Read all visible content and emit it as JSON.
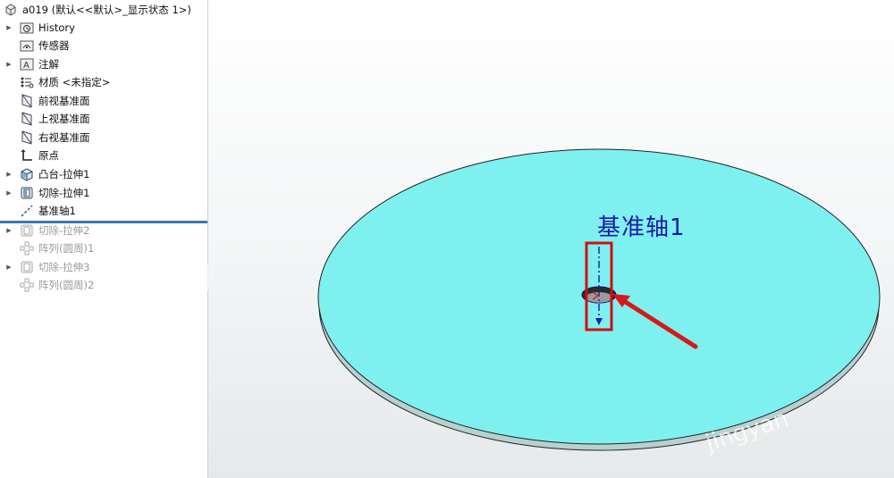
{
  "tree": {
    "root": "a019  (默认<<默认>_显示状态 1>)",
    "items": [
      {
        "label": "History",
        "icon": "history-folder-icon",
        "expandable": true,
        "suppressed": false
      },
      {
        "label": "传感器",
        "icon": "sensor-icon",
        "expandable": false,
        "suppressed": false
      },
      {
        "label": "注解",
        "icon": "annotation-icon",
        "expandable": true,
        "suppressed": false
      },
      {
        "label": "材质 <未指定>",
        "icon": "material-icon",
        "expandable": false,
        "suppressed": false
      },
      {
        "label": "前视基准面",
        "icon": "plane-icon",
        "expandable": false,
        "suppressed": false
      },
      {
        "label": "上视基准面",
        "icon": "plane-icon",
        "expandable": false,
        "suppressed": false
      },
      {
        "label": "右视基准面",
        "icon": "plane-icon",
        "expandable": false,
        "suppressed": false
      },
      {
        "label": "原点",
        "icon": "origin-icon",
        "expandable": false,
        "suppressed": false
      },
      {
        "label": "凸台-拉伸1",
        "icon": "boss-extrude-icon",
        "expandable": true,
        "suppressed": false
      },
      {
        "label": "切除-拉伸1",
        "icon": "cut-extrude-icon",
        "expandable": true,
        "suppressed": false
      },
      {
        "label": "基准轴1",
        "icon": "reference-axis-icon",
        "expandable": false,
        "suppressed": false
      },
      {
        "label": "切除-拉伸2",
        "icon": "cut-extrude-icon",
        "expandable": true,
        "suppressed": true
      },
      {
        "label": "阵列(圆周)1",
        "icon": "circular-pattern-icon",
        "expandable": false,
        "suppressed": true
      },
      {
        "label": "切除-拉伸3",
        "icon": "cut-extrude-icon",
        "expandable": true,
        "suppressed": true
      },
      {
        "label": "阵列(圆周)2",
        "icon": "circular-pattern-icon",
        "expandable": false,
        "suppressed": true
      }
    ]
  },
  "viewport": {
    "axis_label": "基准轴1",
    "disc_color": "#7ff0f0",
    "edge_color": "#b7d0d2",
    "label_color": "#1a1aa8",
    "highlight_color": "#d01010"
  },
  "watermark": "jingyan"
}
